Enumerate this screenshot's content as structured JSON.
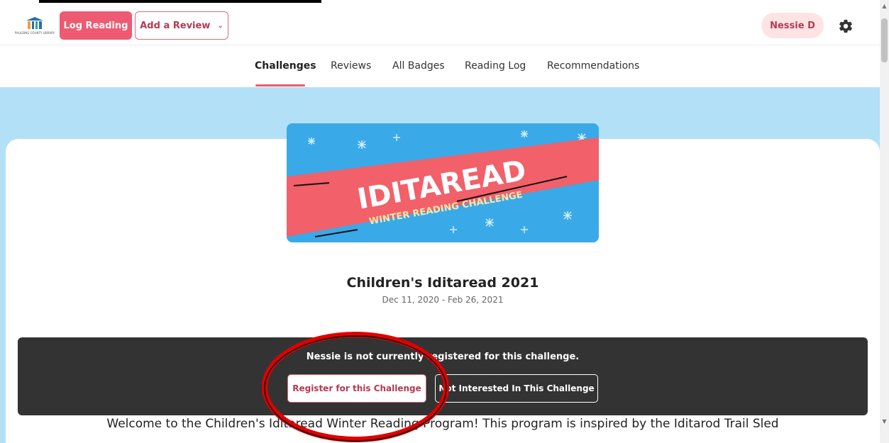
{
  "header": {
    "logo_text": "PAULDING COUNTY LIBRARY",
    "log_reading_label": "Log Reading",
    "add_review_label": "Add a Review",
    "user_name": "Nessie D"
  },
  "nav": {
    "tabs": [
      {
        "label": "Challenges",
        "active": true
      },
      {
        "label": "Reviews",
        "active": false
      },
      {
        "label": "All Badges",
        "active": false
      },
      {
        "label": "Reading Log",
        "active": false
      },
      {
        "label": "Recommendations",
        "active": false
      }
    ]
  },
  "banner": {
    "title_main": "IDITAREAD",
    "title_sub": "WINTER READING CHALLENGE"
  },
  "challenge": {
    "title": "Children's Iditaread 2021",
    "dates": "Dec 11, 2020 - Feb 26, 2021"
  },
  "registration": {
    "message": "Nessie is not currently registered for this challenge.",
    "register_label": "Register for this Challenge",
    "not_interested_label": "Not Interested In This Challenge"
  },
  "welcome_text": "Welcome to the Children's Iditaread Winter Reading Program! This program is inspired by the Iditarod Trail Sled",
  "colors": {
    "brand_pink": "#ee5a72",
    "hero_blue": "#b2e0f7",
    "panel_dark": "#333333",
    "annotation_red": "#e00000"
  },
  "icons": {
    "settings": "gear-icon",
    "dropdown": "chevron-down-icon"
  }
}
